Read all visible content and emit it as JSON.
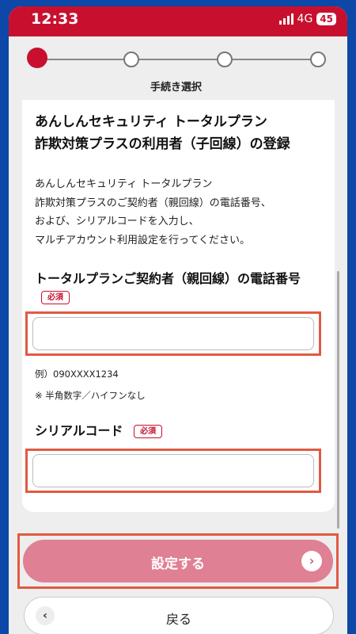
{
  "status_bar": {
    "time": "12:33",
    "network": "4G",
    "battery": "45"
  },
  "stepper": {
    "current_label": "手続き選択",
    "total_steps": 4,
    "current_step": 1
  },
  "card": {
    "title_line1": "あんしんセキュリティ トータルプラン",
    "title_line2": "詐欺対策プラスの利用者（子回線）の登録",
    "description": [
      "あんしんセキュリティ トータルプラン",
      "詐欺対策プラスのご契約者（親回線）の電話番号、",
      "および、シリアルコードを入力し、",
      "マルチアカウント利用設定を行ってください。"
    ]
  },
  "phone_field": {
    "label": "トータルプランご契約者（親回線）の電話番号",
    "required": "必須",
    "value": "",
    "example": "例）090XXXX1234",
    "note": "※ 半角数字／ハイフンなし"
  },
  "serial_field": {
    "label": "シリアルコード",
    "required": "必須",
    "value": ""
  },
  "buttons": {
    "submit": "設定する",
    "back": "戻る"
  },
  "colors": {
    "brand": "#c8102e",
    "submit_bg": "#e08094",
    "highlight": "#e05a43",
    "frame": "#0d47a8"
  }
}
